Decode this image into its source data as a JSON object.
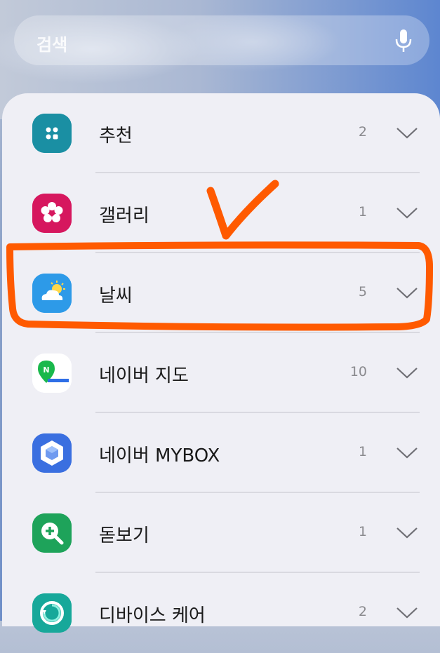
{
  "search": {
    "placeholder": "검색",
    "mic_icon": "microphone-icon"
  },
  "apps": [
    {
      "name": "추천",
      "count": "2",
      "icon": "grid-dots-icon",
      "color": "#1a8fa3"
    },
    {
      "name": "갤러리",
      "count": "1",
      "icon": "flower-icon",
      "color": "#d6175e"
    },
    {
      "name": "날씨",
      "count": "5",
      "icon": "sun-cloud-icon",
      "color": "#2d9ae8"
    },
    {
      "name": "네이버 지도",
      "count": "10",
      "icon": "naver-map-icon",
      "color": "#ffffff"
    },
    {
      "name": "네이버 MYBOX",
      "count": "1",
      "icon": "cube-icon",
      "color": "#3a6fe0"
    },
    {
      "name": "돋보기",
      "count": "1",
      "icon": "magnifier-plus-icon",
      "color": "#1ea35a"
    },
    {
      "name": "디바이스 케어",
      "count": "2",
      "icon": "device-care-icon",
      "color": "#17a89a"
    }
  ],
  "annotation": {
    "color": "#ff5a00",
    "highlighted_item": "날씨"
  }
}
